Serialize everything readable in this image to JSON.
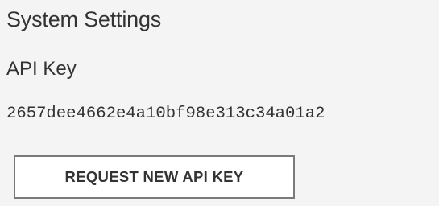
{
  "settings": {
    "title": "System Settings",
    "api_key_label": "API Key",
    "api_key_value": "2657dee4662e4a10bf98e313c34a01a2",
    "request_button_label": "REQUEST NEW API KEY"
  }
}
